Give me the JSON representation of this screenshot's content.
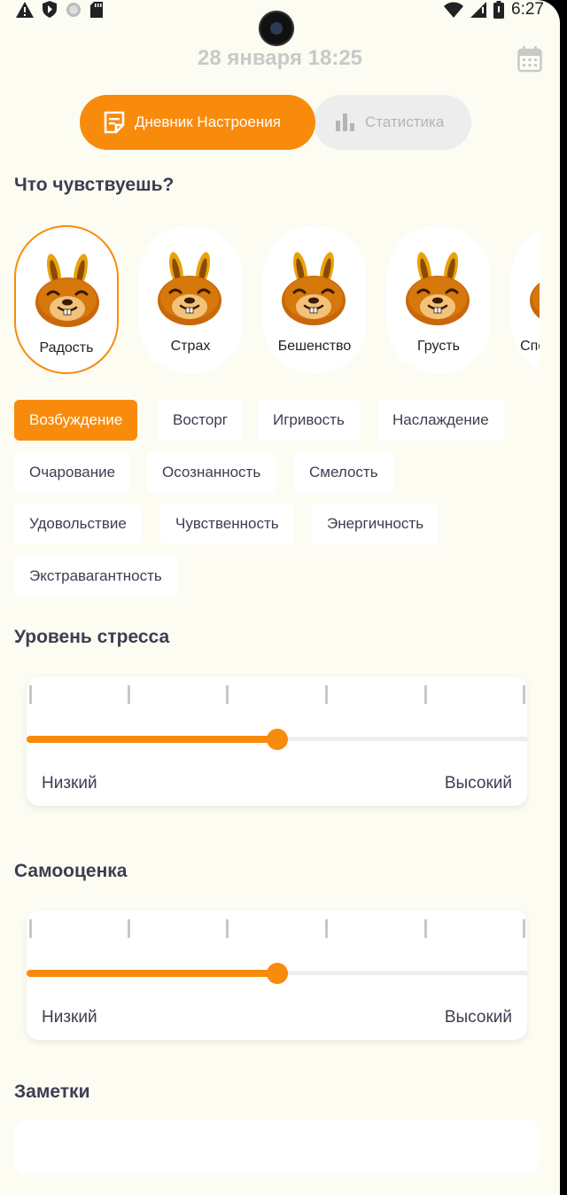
{
  "status_bar": {
    "time": "6:27",
    "icons": [
      "warning-icon",
      "shield-icon",
      "circle-icon",
      "sd-card-icon",
      "wifi-icon",
      "signal-icon",
      "battery-icon"
    ]
  },
  "header": {
    "date": "28 января 18:25",
    "calendar_icon": "calendar-icon"
  },
  "tabs": [
    {
      "label": "Дневник Настроения",
      "icon": "notes-icon",
      "active": true
    },
    {
      "label": "Статистика",
      "icon": "bar-chart-icon",
      "active": false
    }
  ],
  "mood_section": {
    "title": "Что чувствуешь?",
    "moods": [
      {
        "label": "Радость",
        "selected": true
      },
      {
        "label": "Страх",
        "selected": false
      },
      {
        "label": "Бешенство",
        "selected": false
      },
      {
        "label": "Грусть",
        "selected": false
      },
      {
        "label": "Спокойствие",
        "selected": false
      }
    ]
  },
  "tags": [
    {
      "label": "Возбуждение",
      "active": true
    },
    {
      "label": "Восторг",
      "active": false
    },
    {
      "label": "Игривость",
      "active": false
    },
    {
      "label": "Наслаждение",
      "active": false
    },
    {
      "label": "Очарование",
      "active": false
    },
    {
      "label": "Осознанность",
      "active": false
    },
    {
      "label": "Смелость",
      "active": false
    },
    {
      "label": "Удовольствие",
      "active": false
    },
    {
      "label": "Чувственность",
      "active": false
    },
    {
      "label": "Энергичность",
      "active": false
    },
    {
      "label": "Экстравагантность",
      "active": false
    }
  ],
  "stress": {
    "title": "Уровень стресса",
    "value": 0.5,
    "low_label": "Низкий",
    "high_label": "Высокий"
  },
  "self_esteem": {
    "title": "Самооценка",
    "value": 0.5,
    "low_label": "Низкий",
    "high_label": "Высокий"
  },
  "notes": {
    "title": "Заметки"
  },
  "colors": {
    "accent": "#f98b0c",
    "background": "#fcfcf2",
    "text": "#3d3d52",
    "muted": "#c9c9c9"
  }
}
